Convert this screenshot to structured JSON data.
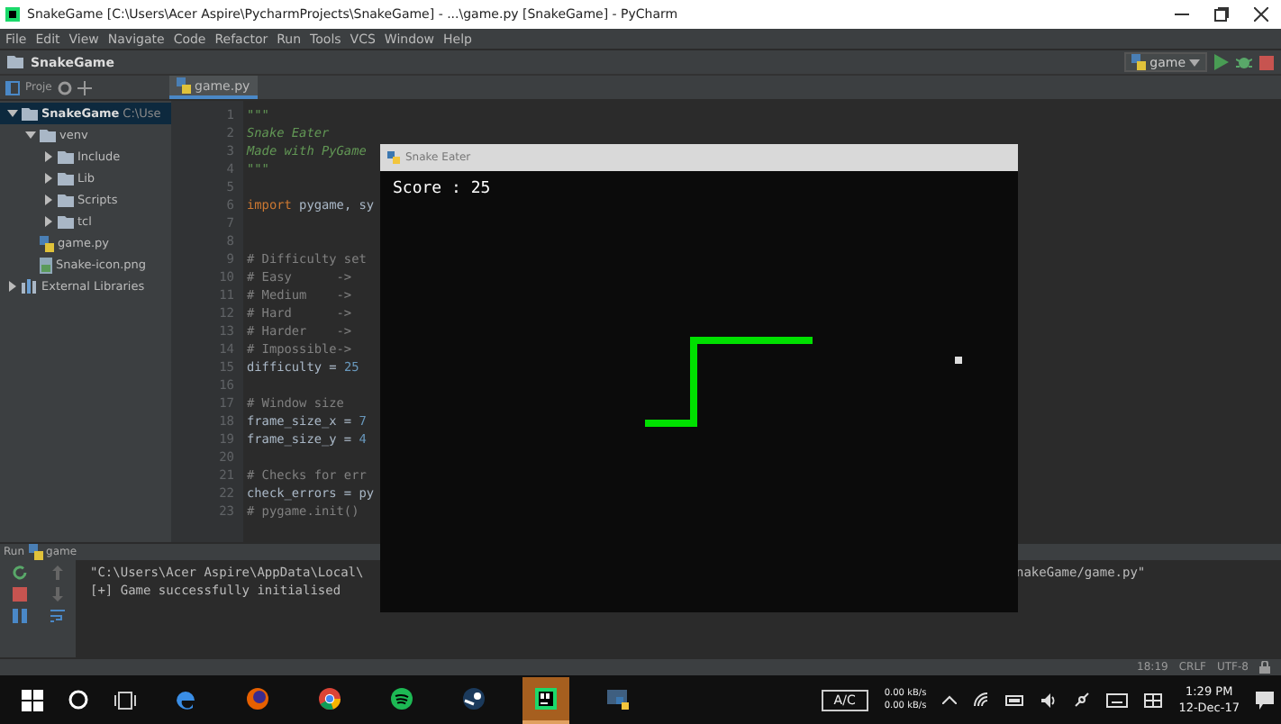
{
  "window": {
    "title": "SnakeGame [C:\\Users\\Acer Aspire\\PycharmProjects\\SnakeGame] - ...\\game.py [SnakeGame] - PyCharm"
  },
  "menu": [
    "File",
    "Edit",
    "View",
    "Navigate",
    "Code",
    "Refactor",
    "Run",
    "Tools",
    "VCS",
    "Window",
    "Help"
  ],
  "breadcrumb": "SnakeGame",
  "run_config": "game",
  "project_label": "Proje",
  "tabs": [
    {
      "label": "game.py",
      "selected": true
    }
  ],
  "tree": [
    {
      "label": "SnakeGame",
      "path": "C:\\Use",
      "kind": "folder",
      "expanded": true,
      "children": [
        {
          "label": "venv",
          "kind": "folder",
          "expanded": true,
          "children": [
            {
              "label": "Include",
              "kind": "folder",
              "expanded": false
            },
            {
              "label": "Lib",
              "kind": "folder",
              "expanded": false
            },
            {
              "label": "Scripts",
              "kind": "folder",
              "expanded": false
            },
            {
              "label": "tcl",
              "kind": "folder",
              "expanded": false
            }
          ]
        },
        {
          "label": "game.py",
          "kind": "python"
        },
        {
          "label": "Snake-icon.png",
          "kind": "image"
        }
      ]
    },
    {
      "label": "External Libraries",
      "kind": "library",
      "expanded": false
    }
  ],
  "code": [
    {
      "n": "1",
      "parts": [
        {
          "kind": "doc",
          "text": "\"\"\""
        }
      ]
    },
    {
      "n": "2",
      "parts": [
        {
          "kind": "doc",
          "text": "Snake Eater"
        }
      ]
    },
    {
      "n": "3",
      "parts": [
        {
          "kind": "doc",
          "text": "Made with PyGame"
        }
      ]
    },
    {
      "n": "4",
      "parts": [
        {
          "kind": "doc",
          "text": "\"\"\""
        }
      ]
    },
    {
      "n": "5"
    },
    {
      "n": "6",
      "parts": [
        {
          "kind": "kw",
          "text": "import"
        },
        {
          "kind": "plain",
          "text": " pygame, sy"
        }
      ]
    },
    {
      "n": "7"
    },
    {
      "n": "8"
    },
    {
      "n": "9",
      "parts": [
        {
          "kind": "comment",
          "text": "# Difficulty set"
        }
      ]
    },
    {
      "n": "10",
      "parts": [
        {
          "kind": "comment",
          "text": "# Easy      ->"
        }
      ]
    },
    {
      "n": "11",
      "parts": [
        {
          "kind": "comment",
          "text": "# Medium    ->"
        }
      ]
    },
    {
      "n": "12",
      "parts": [
        {
          "kind": "comment",
          "text": "# Hard      ->"
        }
      ]
    },
    {
      "n": "13",
      "parts": [
        {
          "kind": "comment",
          "text": "# Harder    ->"
        }
      ]
    },
    {
      "n": "14",
      "parts": [
        {
          "kind": "comment",
          "text": "# Impossible->"
        }
      ]
    },
    {
      "n": "15",
      "parts": [
        {
          "kind": "plain",
          "text": "difficulty = "
        },
        {
          "kind": "num",
          "text": "25"
        }
      ]
    },
    {
      "n": "16"
    },
    {
      "n": "17",
      "parts": [
        {
          "kind": "comment",
          "text": "# Window size"
        }
      ]
    },
    {
      "n": "18",
      "parts": [
        {
          "kind": "plain",
          "text": "frame_size_x = "
        },
        {
          "kind": "num",
          "text": "7"
        }
      ]
    },
    {
      "n": "19",
      "parts": [
        {
          "kind": "plain",
          "text": "frame_size_y = "
        },
        {
          "kind": "num",
          "text": "4"
        }
      ]
    },
    {
      "n": "20"
    },
    {
      "n": "21",
      "parts": [
        {
          "kind": "comment",
          "text": "# Checks for err"
        }
      ]
    },
    {
      "n": "22",
      "parts": [
        {
          "kind": "plain",
          "text": "check_errors = py"
        }
      ]
    },
    {
      "n": "23",
      "parts": [
        {
          "kind": "comment",
          "text": "# pygame.init()"
        }
      ]
    }
  ],
  "run_panel": {
    "label": "Run",
    "config": "game",
    "output": [
      {
        "left": "\"C:\\Users\\Acer Aspire\\AppData\\Local\\",
        "right": "nakeGame/game.py\""
      },
      {
        "left": "[+] Game successfully initialised"
      }
    ]
  },
  "status_bar": {
    "position": "18:19",
    "line_sep": "CRLF",
    "encoding": "UTF-8"
  },
  "game_window": {
    "title": "Snake Eater",
    "score": "Score : 25"
  },
  "taskbar": {
    "apps": [
      {
        "kind": "edge",
        "selected": false
      },
      {
        "kind": "firefox",
        "selected": false
      },
      {
        "kind": "chrome",
        "selected": false
      },
      {
        "kind": "spotify",
        "selected": false
      },
      {
        "kind": "steam",
        "selected": false
      },
      {
        "kind": "pycharm",
        "selected": true
      },
      {
        "kind": "python",
        "selected": false
      }
    ],
    "power": "A/C",
    "net_up": "0.00 kB/s",
    "net_down": "0.00 kB/s",
    "time": "1:29 PM",
    "date": "12-Dec-17"
  }
}
